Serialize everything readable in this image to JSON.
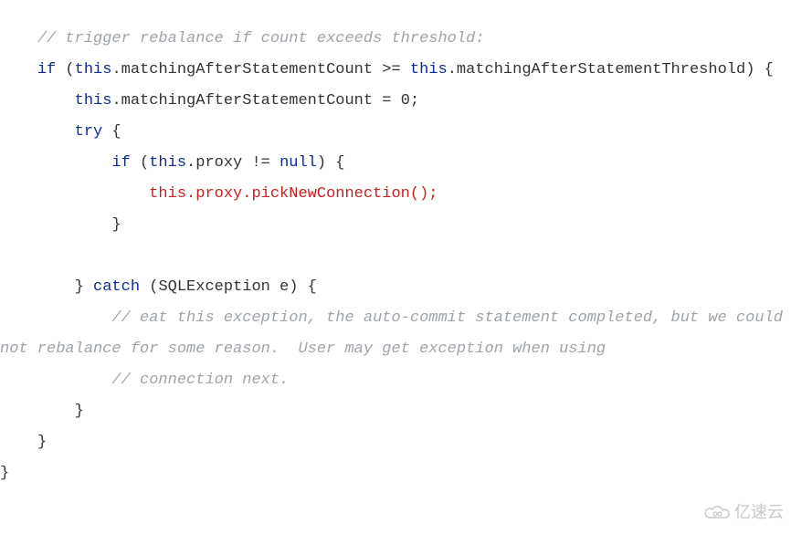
{
  "code": {
    "comment1": "// trigger rebalance if count exceeds threshold:",
    "if_kw": "if",
    "this_kw": "this",
    "dot": ".",
    "member_count": "matchingAfterStatementCount",
    "op_gte": " >= ",
    "member_thresh": "matchingAfterStatementThreshold",
    "assign_zero": " = 0",
    "semicolon": ";",
    "try_kw": "try",
    "proxy": "proxy",
    "op_neq": " != ",
    "null_kw": "null",
    "call_pick": "this.proxy.pickNewConnection();",
    "catch_kw": "catch",
    "exc_type": "SQLException",
    "exc_var": " e",
    "comment2a": "// eat this exception, the auto-commit statement completed, but we could not rebalance for some reason.  User may get exception when using",
    "comment3": "// connection next.",
    "lparen": " (",
    "rparen": ")",
    "lbrace": " {",
    "rbrace": "}"
  },
  "watermark": {
    "text": "亿速云"
  }
}
